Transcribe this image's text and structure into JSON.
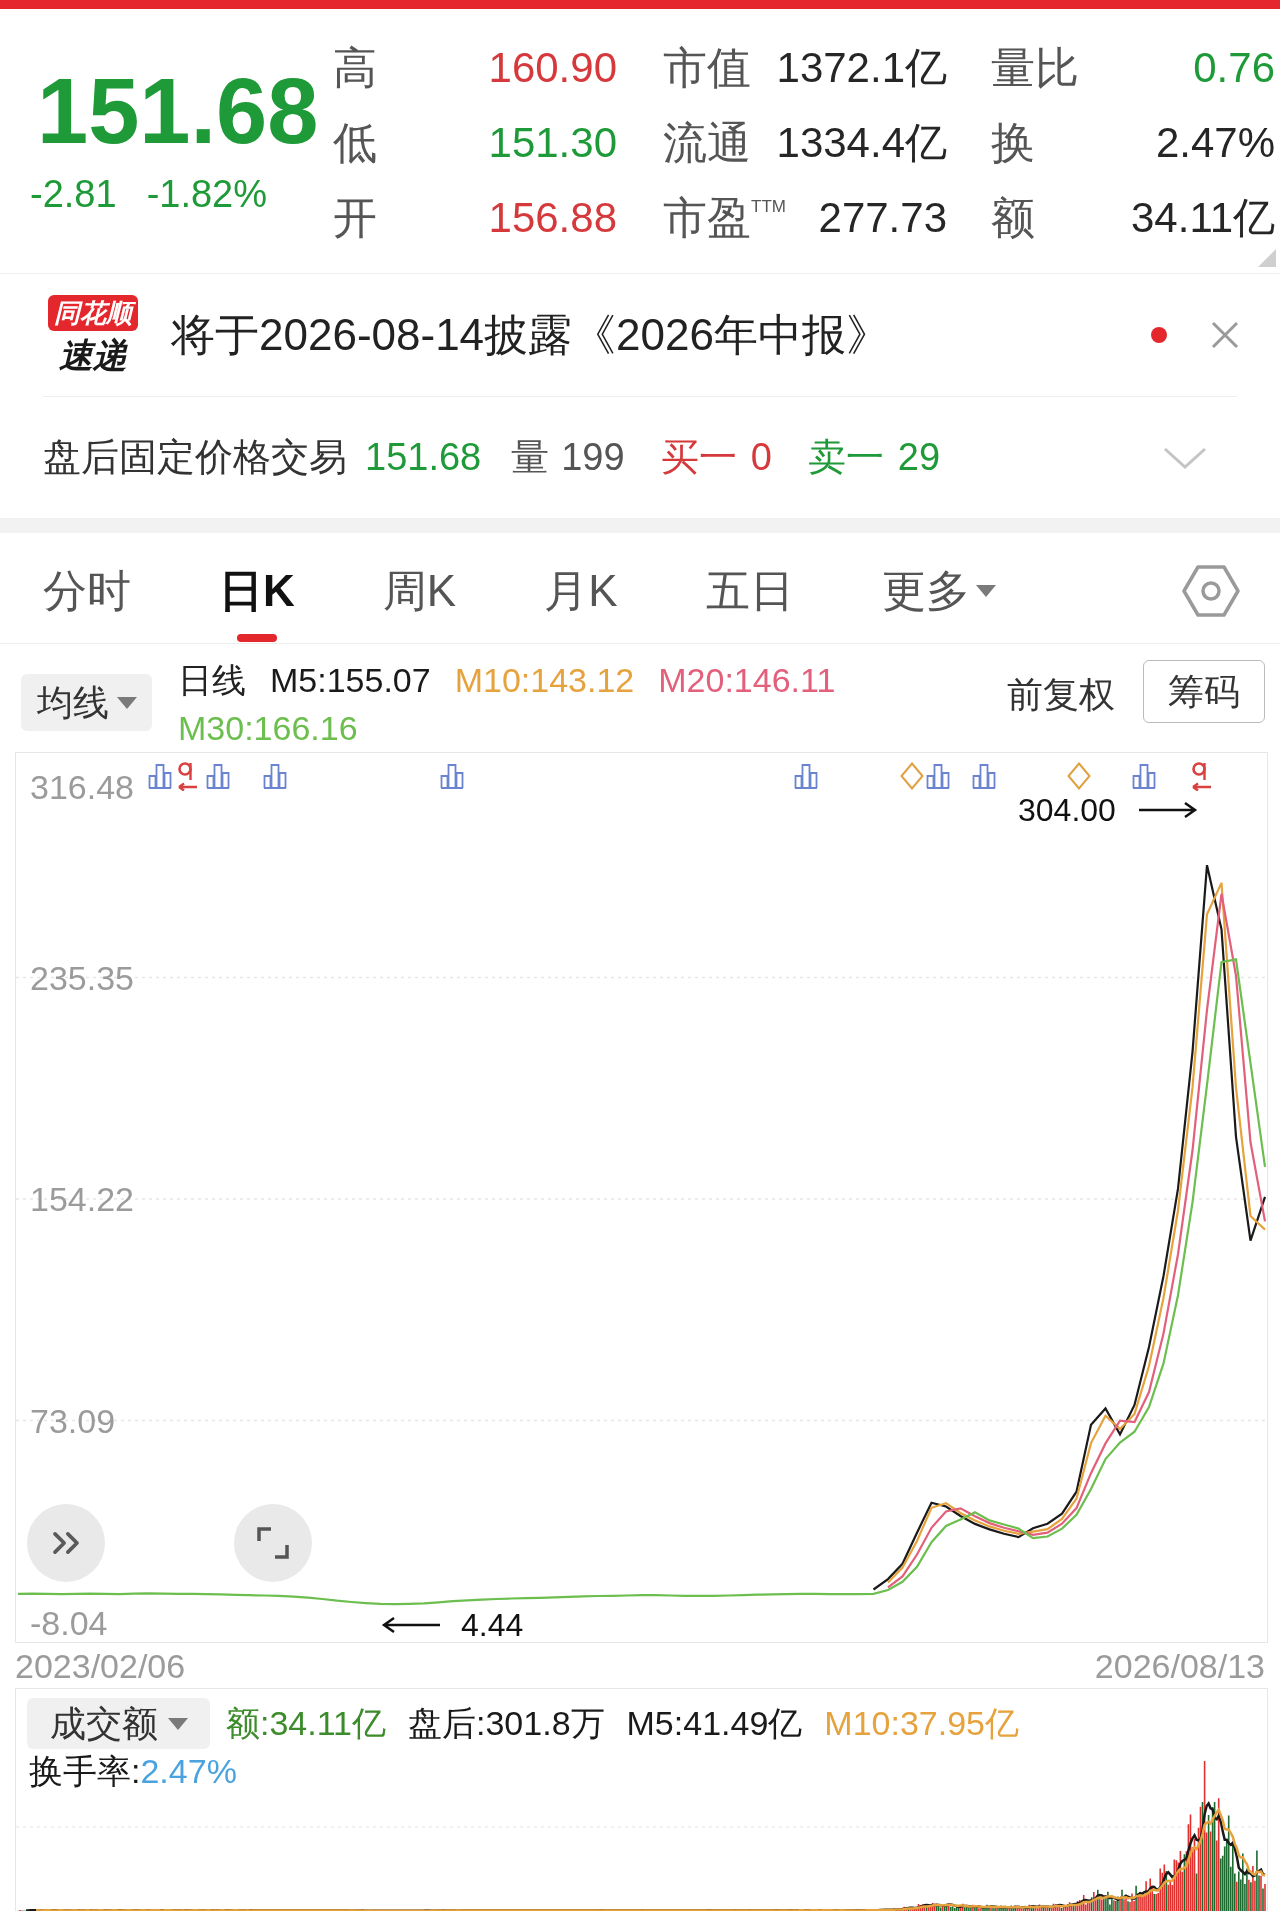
{
  "header": {
    "price": "151.68",
    "change": "-2.81",
    "change_percent": "-1.82%",
    "color": "#1f9a38"
  },
  "stat_rows": [
    [
      {
        "label": "高",
        "value": "160.90",
        "color": "#d6393c"
      },
      {
        "label": "市值",
        "value": "1372.1亿",
        "color": "#262626"
      },
      {
        "label": "量比",
        "value": "0.76",
        "color": "#1f9a38"
      }
    ],
    [
      {
        "label": "低",
        "value": "151.30",
        "color": "#1f9a38"
      },
      {
        "label": "流通",
        "value": "1334.4亿",
        "color": "#262626"
      },
      {
        "label": "换",
        "value": "2.47%",
        "color": "#262626"
      }
    ],
    [
      {
        "label": "开",
        "value": "156.88",
        "color": "#d6393c"
      },
      {
        "label": "市盈$^{TTM}$",
        "value": "277.73",
        "color": "#262626"
      },
      {
        "label": "额",
        "value": "34.11亿",
        "color": "#262626"
      }
    ]
  ],
  "news": {
    "logo_top": "同花顺",
    "logo_bottom": "速递",
    "text": "将于2026-08-14披露《2026年中报》",
    "unread": true
  },
  "after_hours": {
    "label": "盘后固定价格交易",
    "price": "151.68",
    "volume_label": "量",
    "volume": "199",
    "bid_label": "买一",
    "bid": "0",
    "ask_label": "卖一",
    "ask": "29",
    "expanded": false
  },
  "tabs": [
    {
      "label": "分时",
      "selected": false,
      "kind": "tab"
    },
    {
      "label": "日K",
      "selected": true,
      "kind": "tab"
    },
    {
      "label": "周K",
      "selected": false,
      "kind": "tab"
    },
    {
      "label": "月K",
      "selected": false,
      "kind": "tab"
    },
    {
      "label": "五日",
      "selected": false,
      "kind": "tab"
    },
    {
      "label": "更多",
      "selected": false,
      "kind": "menu"
    }
  ],
  "ma_bar": {
    "indicator": "均线",
    "period": "日线",
    "adjustment": "前复权",
    "chips_button": "筹码"
  },
  "chart": {
    "chart_data": {
      "type": "line",
      "categories": [
        null,
        null,
        null,
        null,
        null,
        null,
        null,
        null,
        null,
        null,
        null,
        null,
        null,
        null,
        null,
        null,
        null,
        null,
        null,
        null,
        null,
        null,
        null,
        null,
        null,
        null,
        null,
        null,
        null,
        null,
        null,
        null,
        null,
        null,
        null,
        null,
        null,
        null,
        null,
        null,
        null,
        null,
        null,
        null,
        null,
        null,
        null,
        null,
        null,
        null,
        null,
        null,
        null,
        null,
        null,
        null,
        null,
        null,
        null,
        null,
        null,
        null,
        null,
        null,
        null,
        null,
        null,
        null,
        null,
        null,
        null,
        null,
        null,
        null,
        null,
        null,
        null,
        null,
        null,
        null,
        null,
        null,
        null,
        null,
        null,
        null,
        null
      ],
      "ylim": [
        -8.04,
        316.48
      ],
      "yticks": [
        {
          "value": 316.48,
          "label": "316.48"
        },
        {
          "value": 235.35,
          "label": "235.35"
        },
        {
          "value": 154.22,
          "label": "154.22"
        },
        {
          "value": 73.09,
          "label": "73.09"
        },
        {
          "value": -8.04,
          "label": "-8.04"
        }
      ],
      "grid": true,
      "series": [
        {
          "name": "M5:155.07",
          "color": "#1a1a1a",
          "values": [
            null,
            null,
            null,
            null,
            null,
            null,
            null,
            null,
            null,
            null,
            null,
            null,
            null,
            null,
            null,
            null,
            null,
            null,
            null,
            null,
            null,
            null,
            null,
            null,
            null,
            null,
            null,
            null,
            null,
            null,
            null,
            null,
            null,
            null,
            null,
            null,
            null,
            null,
            null,
            null,
            null,
            null,
            null,
            null,
            null,
            null,
            null,
            null,
            null,
            null,
            null,
            null,
            null,
            null,
            null,
            null,
            null,
            null,
            null,
            11.2,
            15,
            20.6,
            32,
            43,
            41.6,
            38.1,
            35.2,
            33.2,
            31.6,
            30.4,
            33.6,
            35.3,
            39,
            47,
            71.5,
            77.5,
            68,
            78.8,
            100,
            126,
            158,
            208,
            276.5,
            253,
            177,
            139,
            155
          ]
        },
        {
          "name": "M10:143.12",
          "color": "#e6a23c",
          "values": [
            null,
            null,
            null,
            null,
            null,
            null,
            null,
            null,
            null,
            null,
            null,
            null,
            null,
            null,
            null,
            null,
            null,
            null,
            null,
            null,
            null,
            null,
            null,
            null,
            null,
            null,
            null,
            null,
            null,
            null,
            null,
            null,
            null,
            null,
            null,
            null,
            null,
            null,
            null,
            null,
            null,
            null,
            null,
            null,
            null,
            null,
            null,
            null,
            null,
            null,
            null,
            null,
            null,
            null,
            null,
            null,
            null,
            null,
            null,
            null,
            13.8,
            19.2,
            29,
            41.1,
            42.8,
            39.2,
            36.5,
            34.3,
            32.7,
            31.6,
            32.4,
            33.3,
            37,
            44.5,
            64.8,
            74.8,
            70,
            75.5,
            93,
            118,
            150,
            195,
            258.5,
            270,
            195,
            148,
            143
          ]
        },
        {
          "name": "M20:146.11",
          "color": "#e2607b",
          "values": [
            null,
            null,
            null,
            null,
            null,
            null,
            null,
            null,
            null,
            null,
            null,
            null,
            null,
            null,
            null,
            null,
            null,
            null,
            null,
            null,
            null,
            null,
            null,
            null,
            null,
            null,
            null,
            null,
            null,
            null,
            null,
            null,
            null,
            null,
            null,
            null,
            null,
            null,
            null,
            null,
            null,
            null,
            null,
            null,
            null,
            null,
            null,
            null,
            null,
            null,
            null,
            null,
            null,
            null,
            null,
            null,
            null,
            null,
            null,
            null,
            12,
            16,
            24,
            33.8,
            39.8,
            40.9,
            38,
            35.5,
            33.8,
            32.5,
            31.2,
            32,
            35.3,
            41,
            53.8,
            64.7,
            73,
            72.5,
            83.5,
            105,
            134,
            172,
            223.5,
            266,
            236,
            175,
            146
          ]
        },
        {
          "name": "M30:166.16",
          "color": "#6cbe4e",
          "values": [
            9.6,
            9.7,
            9.6,
            9.5,
            9.6,
            9.7,
            9.6,
            9.5,
            9.7,
            9.8,
            9.7,
            9.6,
            9.6,
            9.5,
            9.4,
            9.2,
            9.1,
            9.0,
            8.9,
            8.6,
            8.2,
            7.7,
            7.1,
            6.6,
            6.2,
            5.9,
            5.8,
            5.9,
            6.1,
            6.5,
            6.9,
            7.2,
            7.5,
            7.7,
            7.9,
            8.0,
            8.1,
            8.3,
            8.5,
            8.7,
            8.8,
            8.9,
            9.0,
            9.1,
            9.1,
            9.0,
            8.9,
            8.9,
            8.9,
            9.0,
            9.1,
            9.3,
            9.4,
            9.5,
            9.6,
            9.6,
            9.5,
            9.5,
            9.5,
            9.6,
            11,
            14,
            19.5,
            28.5,
            34.5,
            36.8,
            39.5,
            36.5,
            35,
            33.5,
            30.0,
            30.6,
            33.5,
            38.5,
            48,
            59,
            65,
            69,
            78,
            94,
            119,
            153,
            196,
            241,
            242,
            204,
            166
          ]
        }
      ]
    },
    "high_label": "304.00",
    "low_label": "4.44",
    "start_date": "2023/02/06",
    "end_date": "2026/08/13"
  },
  "volume": {
    "indicator": "成交额",
    "values": [
      {
        "label": "额:34.11亿",
        "color": "#3c8c2c"
      },
      {
        "label": "盘后:301.8万",
        "color": "#1a1a1a"
      },
      {
        "label": "M5:41.49亿",
        "color": "#1a1a1a"
      },
      {
        "label": "M10:37.95亿",
        "color": "#e6a23c"
      }
    ],
    "turnover_label": "换手率:",
    "turnover_value": "2.47%"
  }
}
